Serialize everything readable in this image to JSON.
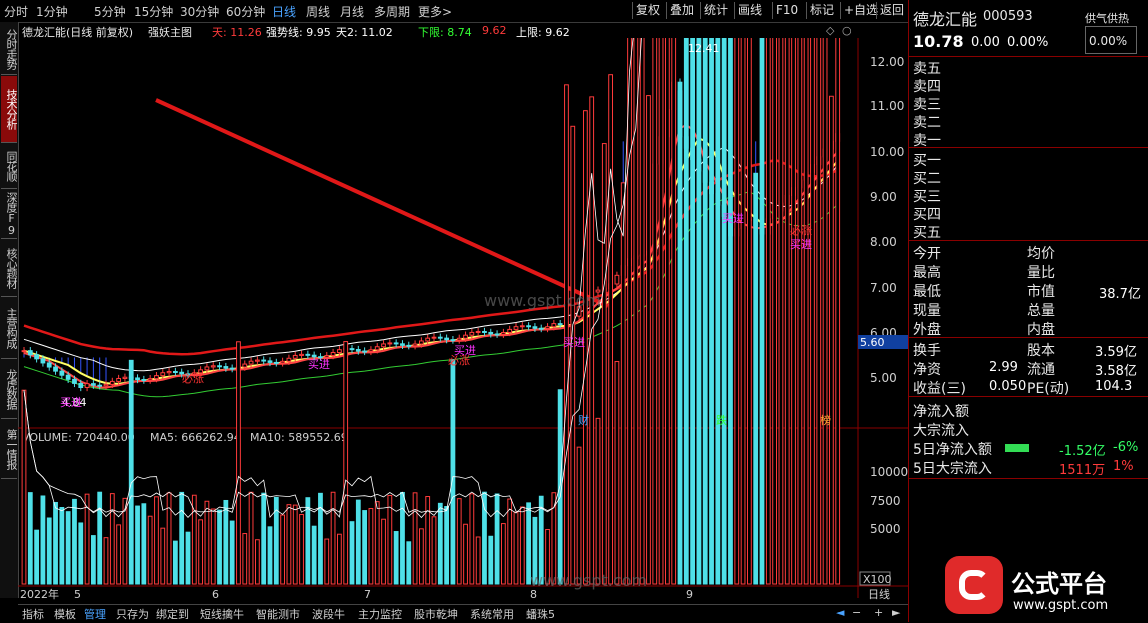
{
  "toolbar": {
    "tabs": [
      "分时",
      "1分钟",
      "5分钟",
      "15分钟",
      "30分钟",
      "60分钟",
      "日线",
      "周线",
      "月线",
      "多周期",
      "更多>"
    ],
    "active_tab": "日线",
    "right_buttons": [
      "复权",
      "叠加",
      "统计",
      "画线",
      "F10",
      "标记",
      "+自选",
      "返回"
    ]
  },
  "left_tabs": [
    "分时走势",
    "技术分析",
    "同花顺",
    "深度F9",
    "核心题材",
    "主营构成",
    "龙虎数据",
    "第一情报"
  ],
  "active_left_tab": "技术分析",
  "chart_header": {
    "stock_name": "德龙汇能(日线 前复权)",
    "indicator": "强妖主图",
    "tian_label": "天: 11.26",
    "qiangshi_label": "强势线: 9.95",
    "tian2_label": "天2: 11.02",
    "xiaxian_label": "下限: 8.74",
    "xiaxian_val2": "9.62",
    "shangxian_label": "上限: 9.62"
  },
  "price_axis": {
    "ticks": [
      "12.00",
      "11.00",
      "10.00",
      "9.00",
      "8.00",
      "7.00",
      "6.00",
      "5.00"
    ],
    "current_price_tag": "5.60",
    "high_label": "12.41",
    "low_label": "4.84"
  },
  "annotations": {
    "buy_labels": [
      "买进",
      "买进",
      "买进",
      "买进",
      "买进",
      "买进"
    ],
    "rise_labels": [
      "必涨",
      "必涨",
      "必涨"
    ],
    "event_labels": [
      "财",
      "跌",
      "榜"
    ]
  },
  "volume_header": {
    "volume": "VOLUME: 720440.00",
    "ma5": "MA5: 666262.94",
    "ma10": "MA10: 589552.69",
    "ticks": [
      "10000",
      "7500",
      "5000"
    ],
    "unit": "X100"
  },
  "date_axis": {
    "year": "2022年",
    "months": [
      "5",
      "6",
      "7",
      "8",
      "9"
    ],
    "period": "日线"
  },
  "bottom_tabs": [
    "指标",
    "模板",
    "管理",
    "只存为",
    "绑定到",
    "短线擒牛",
    "智能测市",
    "波段牛",
    "主力监控",
    "股市乾坤",
    "系统常用",
    "蟠珠5"
  ],
  "active_bottom_tab": "管理",
  "quote": {
    "name": "德龙汇能",
    "code": "000593",
    "extra": "供气供热",
    "price": "10.78",
    "change": "0.00",
    "change_pct": "0.00%",
    "side_pct": "0.00%",
    "sell_levels": [
      "卖五",
      "卖四",
      "卖三",
      "卖二",
      "卖一"
    ],
    "buy_levels": [
      "买一",
      "买二",
      "买三",
      "买四",
      "买五"
    ],
    "stats_left": [
      "今开",
      "最高",
      "最低",
      "现量",
      "外盘"
    ],
    "stats_right": [
      "均价",
      "量比",
      "市值",
      "总量",
      "内盘"
    ],
    "market_cap": "38.7亿",
    "fin_rows": [
      {
        "l": "换手",
        "lv": "",
        "r": "股本",
        "rv": "3.59亿"
      },
      {
        "l": "净资",
        "lv": "2.99",
        "r": "流通",
        "rv": "3.58亿"
      },
      {
        "l": "收益(三)",
        "lv": "0.050",
        "r": "PE(动)",
        "rv": "104.3"
      }
    ],
    "flow_rows": [
      {
        "label": "净流入额",
        "val": "",
        "pct": ""
      },
      {
        "label": "大宗流入",
        "val": "",
        "pct": ""
      },
      {
        "label": "5日净流入额",
        "val": "-1.52亿",
        "pct": "-6%"
      },
      {
        "label": "5日大宗流入",
        "val": "1511万",
        "pct": "1%"
      }
    ]
  },
  "watermark": {
    "url_mid": "www.gspt.com",
    "brand": "公式平台",
    "brand_url": "www.gspt.com"
  },
  "colors": {
    "up": "#ff3b3b",
    "down": "#4fe0e8",
    "buy": "#ff33ff",
    "accent_red": "#cc0000"
  }
}
